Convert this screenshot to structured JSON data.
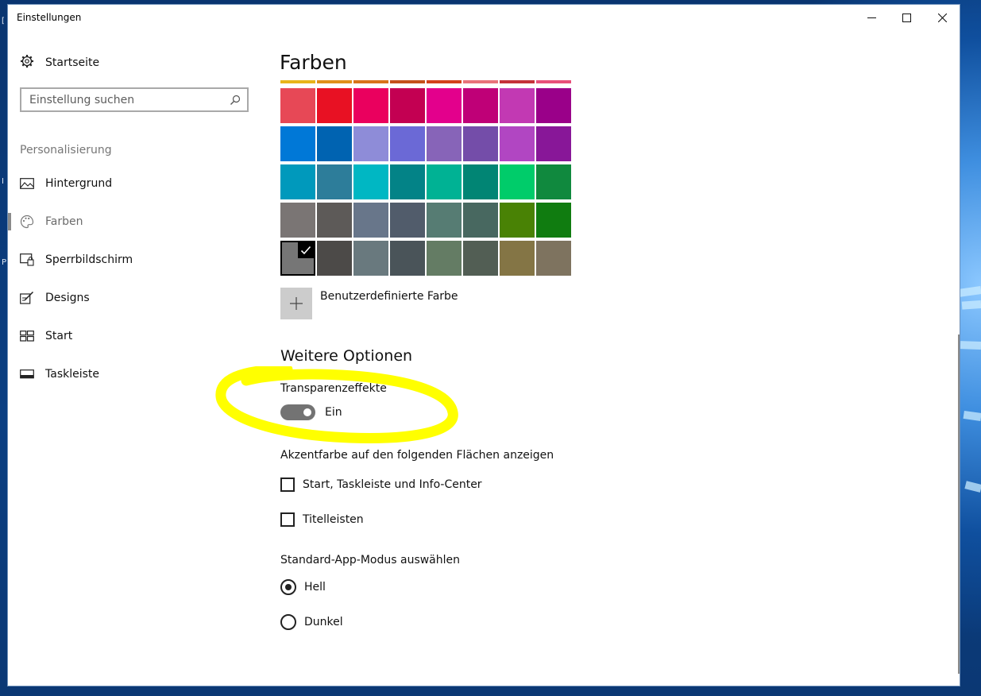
{
  "window": {
    "title": "Einstellungen",
    "controls": {
      "minimize": "—",
      "maximize": "☐",
      "close": "✕"
    }
  },
  "sidebar": {
    "home_label": "Startseite",
    "search_placeholder": "Einstellung suchen",
    "section_label": "Personalisierung",
    "items": [
      {
        "label": "Hintergrund",
        "icon": "picture-icon",
        "active": false
      },
      {
        "label": "Farben",
        "icon": "palette-icon",
        "active": true
      },
      {
        "label": "Sperrbildschirm",
        "icon": "lock-screen-icon",
        "active": false
      },
      {
        "label": "Designs",
        "icon": "brush-icon",
        "active": false
      },
      {
        "label": "Start",
        "icon": "start-icon",
        "active": false
      },
      {
        "label": "Taskleiste",
        "icon": "taskbar-icon",
        "active": false
      }
    ]
  },
  "main": {
    "title": "Farben",
    "swatch_top_row": [
      "#e8b41a",
      "#e0901a",
      "#d8731a",
      "#c4511a",
      "#d3421a",
      "#e8737a",
      "#c4323a",
      "#e8507a"
    ],
    "swatches": [
      [
        "#e74856",
        "#e81123",
        "#ea005e",
        "#c30052",
        "#e3008c",
        "#bf0077",
        "#c239b3",
        "#9a0089"
      ],
      [
        "#0078d7",
        "#0063b1",
        "#8e8cd8",
        "#6b69d6",
        "#8764b8",
        "#744da9",
        "#b146c2",
        "#881798"
      ],
      [
        "#0099bc",
        "#2d7d9a",
        "#00b7c3",
        "#038387",
        "#00b294",
        "#018574",
        "#00cc6a",
        "#10893e"
      ],
      [
        "#7a7574",
        "#5d5a58",
        "#68768a",
        "#515c6b",
        "#567c73",
        "#486860",
        "#498205",
        "#107c10"
      ],
      [
        "#767676",
        "#4c4a48",
        "#69797e",
        "#4a5459",
        "#647c64",
        "#525e54",
        "#847545",
        "#7e735f"
      ]
    ],
    "selected_swatch": {
      "row": 4,
      "col": 0
    },
    "custom_color_label": "Benutzerdefinierte Farbe",
    "more_options_heading": "Weitere Optionen",
    "transparency_label": "Transparenzeffekte",
    "transparency_state": "Ein",
    "transparency_on": true,
    "accent_surfaces_label": "Akzentfarbe auf den folgenden Flächen anzeigen",
    "accent_options": [
      {
        "label": "Start, Taskleiste und Info-Center",
        "checked": false
      },
      {
        "label": "Titelleisten",
        "checked": false
      }
    ],
    "app_mode_label": "Standard-App-Modus auswählen",
    "app_modes": [
      {
        "label": "Hell",
        "selected": true
      },
      {
        "label": "Dunkel",
        "selected": false
      }
    ]
  },
  "desktop_edge_letters": [
    "[",
    "I",
    "P"
  ],
  "colors": {
    "highlight": "#ffff00"
  }
}
